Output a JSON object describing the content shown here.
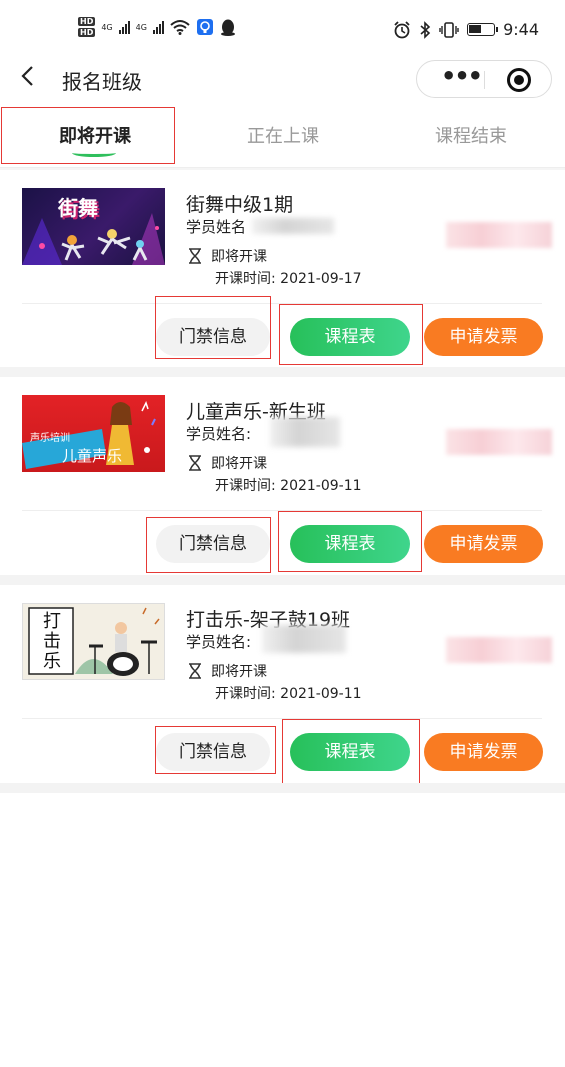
{
  "status_bar": {
    "hd_badges": [
      "HD",
      "HD"
    ],
    "network": [
      "4G",
      "4G"
    ],
    "time": "9:44"
  },
  "nav": {
    "back": "<",
    "title": "报名班级",
    "more": "•••"
  },
  "tabs": [
    {
      "label": "即将开课",
      "active": true
    },
    {
      "label": "正在上课",
      "active": false
    },
    {
      "label": "课程结束",
      "active": false
    }
  ],
  "courses": [
    {
      "name": "街舞中级1期",
      "student_label": "学员姓名",
      "status": "即将开课",
      "start_label": "开课时间:",
      "start_date": "2021-09-17",
      "thumb_text": "街舞",
      "gate_button": "门禁信息",
      "schedule_button": "课程表",
      "invoice_button": "申请发票"
    },
    {
      "name": "儿童声乐-新生班",
      "student_label": "学员姓名:",
      "status": "即将开课",
      "start_label": "开课时间:",
      "start_date": "2021-09-11",
      "thumb_text": "儿童声乐",
      "thumb_subtext": "声乐培训",
      "gate_button": "门禁信息",
      "schedule_button": "课程表",
      "invoice_button": "申请发票"
    },
    {
      "name": "打击乐-架子鼓19班",
      "student_label": "学员姓名:",
      "status": "即将开课",
      "start_label": "开课时间:",
      "start_date": "2021-09-11",
      "thumb_text": "打击乐",
      "gate_button": "门禁信息",
      "schedule_button": "课程表",
      "invoice_button": "申请发票"
    }
  ],
  "colors": {
    "green": "#2fbf5c",
    "orange": "#f97b22",
    "highlight_red": "#e53935"
  }
}
